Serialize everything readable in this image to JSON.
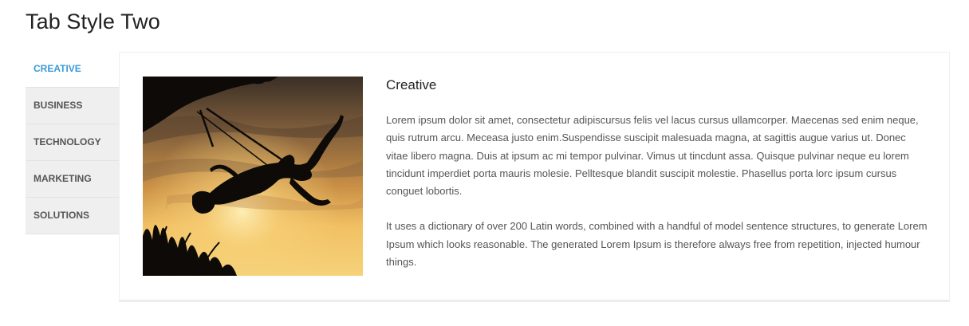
{
  "page": {
    "title": "Tab Style Two"
  },
  "tabs": [
    {
      "label": "CREATIVE",
      "active": true
    },
    {
      "label": "BUSINESS",
      "active": false
    },
    {
      "label": "TECHNOLOGY",
      "active": false
    },
    {
      "label": "MARKETING",
      "active": false
    },
    {
      "label": "SOLUTIONS",
      "active": false
    }
  ],
  "content": {
    "image_subject": "silhouette of woman on swing at sunset",
    "title": "Creative",
    "paragraphs": [
      "Lorem ipsum dolor sit amet, consectetur adipiscursus felis vel lacus cursus ullamcorper. Maecenas sed enim neque, quis rutrum arcu. Meceasa justo enim.Suspendisse suscipit malesuada magna, at sagittis augue varius ut. Donec vitae libero magna. Duis at ipsum ac mi tempor pulvinar. Vimus ut tincdunt assa. Quisque pulvinar neque eu lorem tincidunt imperdiet porta mauris molesie. Pelltesque blandit suscipit molestie. Phasellus porta lorc ipsum cursus conguet lobortis.",
      "It uses a dictionary of over 200 Latin words, combined with a handful of model sentence structures, to generate Lorem Ipsum which looks reasonable. The generated Lorem Ipsum is therefore always free from repetition, injected humour things."
    ]
  },
  "colors": {
    "accent": "#3a9ad9",
    "tab_bg": "#efefef",
    "text": "#555555"
  }
}
